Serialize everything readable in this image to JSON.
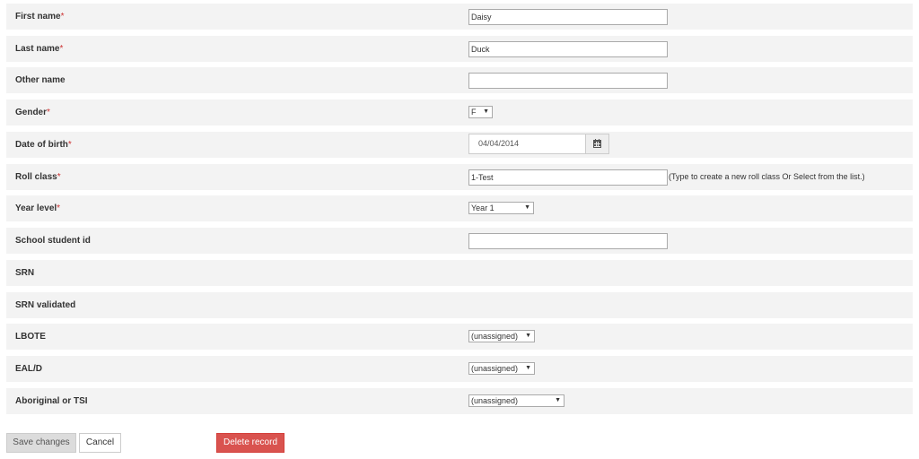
{
  "fields": {
    "first_name": {
      "label": "First name",
      "required": "*",
      "value": "Daisy"
    },
    "last_name": {
      "label": "Last name",
      "required": "*",
      "value": "Duck"
    },
    "other_name": {
      "label": "Other name",
      "value": ""
    },
    "gender": {
      "label": "Gender",
      "required": "*",
      "value": "F"
    },
    "date_of_birth": {
      "label": "Date of birth",
      "required": "*",
      "value": "04/04/2014",
      "icon": "calendar-icon"
    },
    "roll_class": {
      "label": "Roll class",
      "required": "*",
      "value": "1-Test",
      "hint": "(Type to create a new roll class Or Select from the list.)"
    },
    "year_level": {
      "label": "Year level",
      "required": "*",
      "value": "Year 1"
    },
    "school_student_id": {
      "label": "School student id",
      "value": ""
    },
    "srn": {
      "label": "SRN"
    },
    "srn_validated": {
      "label": "SRN validated"
    },
    "lbote": {
      "label": "LBOTE",
      "value": "(unassigned)"
    },
    "eald": {
      "label": "EAL/D",
      "value": "(unassigned)"
    },
    "aboriginal_tsi": {
      "label": "Aboriginal or TSI",
      "value": "(unassigned)"
    }
  },
  "actions": {
    "save_label": "Save changes",
    "cancel_label": "Cancel",
    "delete_label": "Delete record"
  },
  "colors": {
    "row_background": "#f3f3f3",
    "required_marker": "#cc3333",
    "delete_button": "#d9534f",
    "save_button": "#dcdcdc"
  }
}
